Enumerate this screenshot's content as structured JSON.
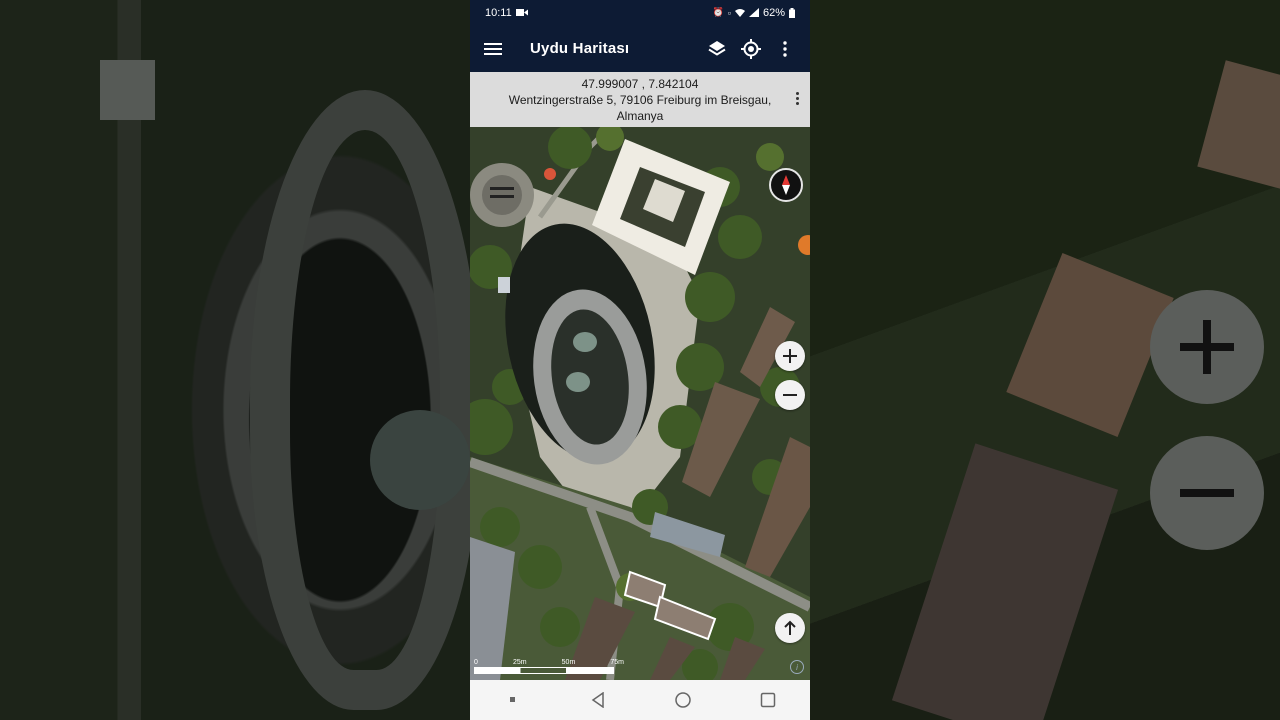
{
  "status_bar": {
    "time": "10:11",
    "battery": "62%",
    "icons": [
      "video-icon",
      "alarm-icon",
      "volte-icon",
      "wifi-icon",
      "signal-icon",
      "battery-icon"
    ]
  },
  "app_bar": {
    "title": "Uydu Haritası",
    "icons": [
      "menu-icon",
      "layers-icon",
      "my-location-icon",
      "more-vert-icon"
    ]
  },
  "location": {
    "coordinates": "47.999007 , 7.842104",
    "address_line1": "Wentzingerstraße 5, 79106 Freiburg im Breisgau,",
    "address_line2": "Almanya"
  },
  "map": {
    "scale_labels": [
      "0",
      "25m",
      "50m",
      "75m"
    ],
    "controls": [
      "compass-icon",
      "zoom-in-button",
      "zoom-out-button",
      "north-up-button",
      "info-icon"
    ]
  },
  "nav_bar": {
    "icons": [
      "recents-dot-icon",
      "back-icon",
      "home-icon",
      "overview-icon"
    ]
  },
  "colors": {
    "app_bar": "#0d1b34",
    "address_bar": "#dcdcdc",
    "nav_bar": "#f5f5f5"
  }
}
